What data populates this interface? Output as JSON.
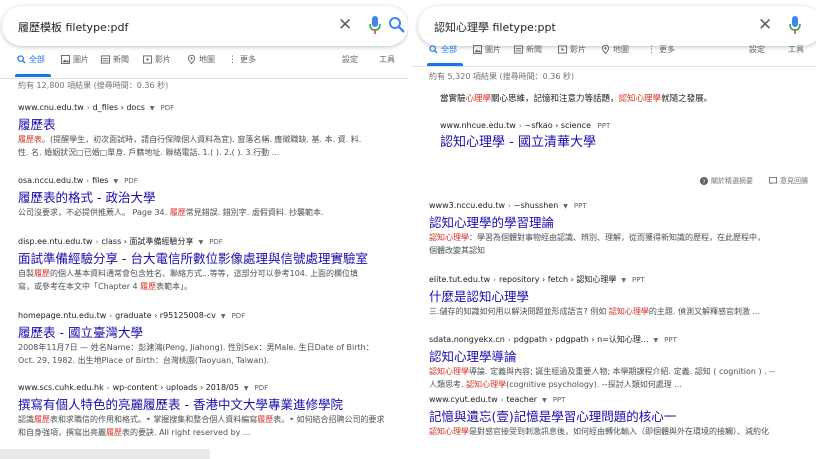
{
  "left": {
    "query": "履歷模板 filetype:pdf",
    "tabs": [
      "全部",
      "圖片",
      "新聞",
      "影片",
      "地圖",
      "更多"
    ],
    "settings": "設定",
    "tools": "工具",
    "stats": "約有 12,800 項結果 (搜尋時間：0.36 秒)",
    "results": [
      {
        "cite": "www.cnu.edu.tw",
        "path": "d_files › docs",
        "type": "PDF",
        "title": "履歷表",
        "snippet": [
          [
            "",
            "履歷表",
            "。(提醒學生，初次面試時，請自行保障個人資料為宜). 窗落名稱. 應徵職缺. 基. 本. 資. 料."
          ],
          [
            "",
            "",
            "性. 名. 婚姻狀況□已婚□單身. 戶籍地址. 聯絡電話. 1.( ). 2.( ). 3.行動 ..."
          ]
        ]
      },
      {
        "cite": "osa.nccu.edu.tw",
        "path": "files",
        "type": "PDF",
        "title": "履歷表的格式 - 政治大學",
        "snippet": [
          [
            "公司沒要求，不必提供推薦人。 Page 34. ",
            "履歷",
            "常見錯誤. 錯別字. 虛假資料. 抄襲範本."
          ]
        ]
      },
      {
        "cite": "disp.ee.ntu.edu.tw",
        "path": "class › 面試準備經驗分享",
        "type": "PDF",
        "title": "面試準備經驗分享 - 台大電信所數位影像處理與信號處理實驗室",
        "snippet": [
          [
            "自製",
            "履歷",
            "的個人基本資料通常會包含姓名、聯絡方式...等等，這部分可以參考104. 上面的欄位填"
          ],
          [
            "寫，或參考在本文中「Chapter 4 ",
            "履歷",
            "表範本」。"
          ]
        ]
      },
      {
        "cite": "homepage.ntu.edu.tw",
        "path": "graduate › r95125008-cv",
        "type": "PDF",
        "title": "履歷表 - 國立臺灣大學",
        "snippet": [
          [
            "2008年11月7日 — 姓名Name：彭建鴻(Peng, Jiahong). 性別Sex：男Male. 生日Date of Birth：",
            "",
            ""
          ],
          [
            "Oct. 29, 1982. 出生地Place of Birth：台灣桃園(Taoyuan, Taiwan).",
            "",
            ""
          ]
        ]
      },
      {
        "cite": "www.scs.cuhk.edu.hk",
        "path": "wp-content › uploads › 2018/05",
        "type": "PDF",
        "title": "撰寫有個人特色的亮麗履歷表 - 香港中文大學專業進修學院",
        "snippet": [
          [
            "認識",
            "履歷",
            "表和求職信的作用和格式。• 掌握搜集和整合個人資料編寫",
            "履歷",
            "表。• 如何結合招聘公司的要求"
          ],
          [
            "和自身強項，撰寫出亮麗",
            "履歷",
            "表的要訣. All right reserved by ..."
          ]
        ]
      }
    ]
  },
  "right": {
    "query": "認知心理學 filetype:ppt",
    "tabs": [
      "全部",
      "圖片",
      "新聞",
      "影片",
      "地圖",
      "更多"
    ],
    "settings": "設定",
    "tools": "工具",
    "stats": "約有 5,320 項結果 (搜尋時間：0.36 秒)",
    "featured": {
      "snippet": [
        "當實驗",
        "心理學",
        "關心思維，記憶和注意力等話題，",
        "認知心理學",
        "就隨之發展。"
      ],
      "cite": "www.nhcue.edu.tw",
      "path": "~sfkao › science",
      "type": "PPT",
      "title": "認知心理學 - 國立清華大學"
    },
    "feedback": {
      "about": "關於精選摘要",
      "feedback": "意見回饋"
    },
    "results": [
      {
        "cite": "www3.nccu.edu.tw",
        "path": "~shusshen",
        "type": "PPT",
        "title": "認知心理學的學習理論",
        "snippet": [
          [
            "",
            "認知心理學",
            "：學習為個體對事物經由認識、辨別、理解，從而獲得新知識的歷程，在此歷程中，"
          ],
          [
            "個體改變其認知",
            "",
            ""
          ]
        ]
      },
      {
        "cite": "elite.tut.edu.tw",
        "path": "repository › fetch › 認知心理學",
        "type": "PPT",
        "title": "什麼是認知心理學",
        "snippet": [
          [
            "三.儲存的知識如何用以解決問題並形成語言? 例如 ",
            "認知心理學",
            "的主題. 偵測又解釋感官刺激 ..."
          ]
        ]
      },
      {
        "cite": "sdata.nongyekx.cn",
        "path": "pdgpath › pdgpath › n=认知心理...",
        "type": "PPT",
        "title": "認知心理學導論",
        "snippet": [
          [
            "",
            "認知心理學",
            "導論. 定義與內容; 誕生經過及重要人物; 本學期課程介紹. 定義. 認知 ( cognition ) . --"
          ],
          [
            "人類思考. ",
            "認知心理學",
            "(cognitive psychology). --探討人類如何處理 ..."
          ]
        ]
      },
      {
        "cite": "www.cyut.edu.tw",
        "path": "teacher",
        "type": "PPT",
        "title": "記憶與遺忘(壹)記憶是學習心理問題的核心一",
        "snippet": [
          [
            "",
            "認知心理學",
            "是對感官接受到刺激訊息後，如何經由轉化輸入（即個體與外在環境的接觸）、減約化"
          ]
        ]
      }
    ]
  }
}
